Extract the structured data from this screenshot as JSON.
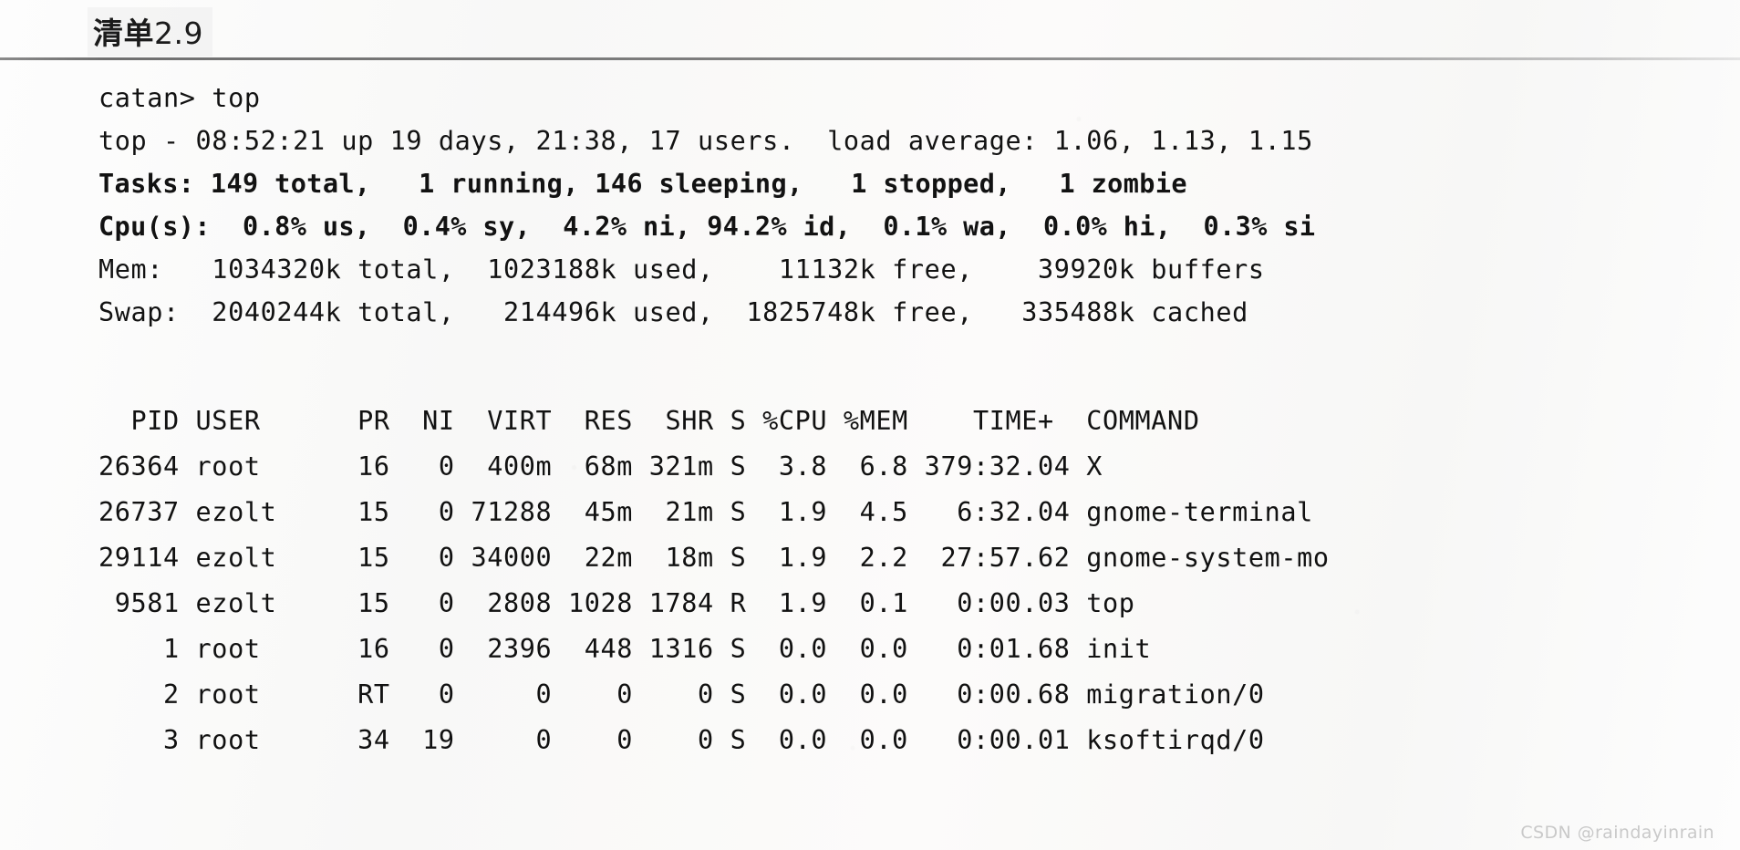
{
  "caption": {
    "label": "清单",
    "number": "2.9"
  },
  "terminal": {
    "prompt_line": "catan> top",
    "uptime_line": "top - 08:52:21 up 19 days, 21:38, 17 users.  load average: 1.06, 1.13, 1.15",
    "tasks_line": "Tasks: 149 total,   1 running, 146 sleeping,   1 stopped,   1 zombie",
    "cpu_line": "Cpu(s):  0.8% us,  0.4% sy,  4.2% ni, 94.2% id,  0.1% wa,  0.0% hi,  0.3% si",
    "mem_line": "Mem:   1034320k total,  1023188k used,    11132k free,    39920k buffers",
    "swap_line": "Swap:  2040244k total,   214496k used,  1825748k free,   335488k cached",
    "header_line": "  PID USER      PR  NI  VIRT  RES  SHR S %CPU %MEM    TIME+  COMMAND",
    "columns": [
      "PID",
      "USER",
      "PR",
      "NI",
      "VIRT",
      "RES",
      "SHR",
      "S",
      "%CPU",
      "%MEM",
      "TIME+",
      "COMMAND"
    ],
    "rows": [
      {
        "line": "26364 root      16   0  400m  68m 321m S  3.8  6.8 379:32.04 X",
        "pid": "26364",
        "user": "root",
        "pr": "16",
        "ni": "0",
        "virt": "400m",
        "res": "68m",
        "shr": "321m",
        "s": "S",
        "cpu": "3.8",
        "mem": "6.8",
        "time": "379:32.04",
        "command": "X"
      },
      {
        "line": "26737 ezolt     15   0 71288  45m  21m S  1.9  4.5   6:32.04 gnome-terminal",
        "pid": "26737",
        "user": "ezolt",
        "pr": "15",
        "ni": "0",
        "virt": "71288",
        "res": "45m",
        "shr": "21m",
        "s": "S",
        "cpu": "1.9",
        "mem": "4.5",
        "time": "6:32.04",
        "command": "gnome-terminal"
      },
      {
        "line": "29114 ezolt     15   0 34000  22m  18m S  1.9  2.2  27:57.62 gnome-system-mo",
        "pid": "29114",
        "user": "ezolt",
        "pr": "15",
        "ni": "0",
        "virt": "34000",
        "res": "22m",
        "shr": "18m",
        "s": "S",
        "cpu": "1.9",
        "mem": "2.2",
        "time": "27:57.62",
        "command": "gnome-system-mo"
      },
      {
        "line": " 9581 ezolt     15   0  2808 1028 1784 R  1.9  0.1   0:00.03 top",
        "pid": "9581",
        "user": "ezolt",
        "pr": "15",
        "ni": "0",
        "virt": "2808",
        "res": "1028",
        "shr": "1784",
        "s": "R",
        "cpu": "1.9",
        "mem": "0.1",
        "time": "0:00.03",
        "command": "top"
      },
      {
        "line": "    1 root      16   0  2396  448 1316 S  0.0  0.0   0:01.68 init",
        "pid": "1",
        "user": "root",
        "pr": "16",
        "ni": "0",
        "virt": "2396",
        "res": "448",
        "shr": "1316",
        "s": "S",
        "cpu": "0.0",
        "mem": "0.0",
        "time": "0:01.68",
        "command": "init"
      },
      {
        "line": "    2 root      RT   0     0    0    0 S  0.0  0.0   0:00.68 migration/0",
        "pid": "2",
        "user": "root",
        "pr": "RT",
        "ni": "0",
        "virt": "0",
        "res": "0",
        "shr": "0",
        "s": "S",
        "cpu": "0.0",
        "mem": "0.0",
        "time": "0:00.68",
        "command": "migration/0"
      },
      {
        "line": "    3 root      34  19     0    0    0 S  0.0  0.0   0:00.01 ksoftirqd/0",
        "pid": "3",
        "user": "root",
        "pr": "34",
        "ni": "19",
        "virt": "0",
        "res": "0",
        "shr": "0",
        "s": "S",
        "cpu": "0.0",
        "mem": "0.0",
        "time": "0:00.01",
        "command": "ksoftirqd/0"
      }
    ]
  },
  "watermark": "CSDN @raindayinrain"
}
